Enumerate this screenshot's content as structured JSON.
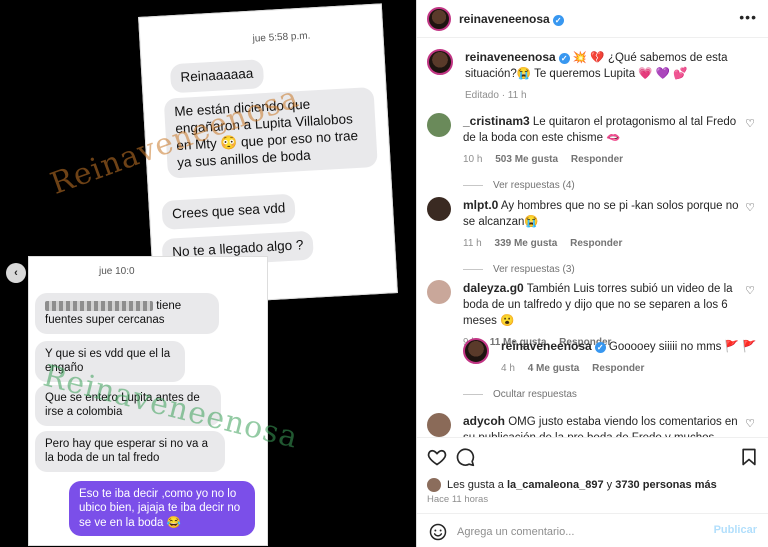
{
  "media": {
    "screenshot_a": {
      "time": "jue 5:58 p.m.",
      "bubbles": [
        "Reinaaaaaa",
        "Me están diciendo que engañaron a Lupita Villalobos en Mty 😳 que por eso no trae ya sus anillos de boda",
        "Crees que sea vdd",
        "No te a llegado algo ?"
      ]
    },
    "screenshot_b": {
      "time": "jue 10:0",
      "bubbles": [
        "tiene fuentes super cercanas",
        "Y que si es vdd que el la engaño",
        "Que se entero Lupita antes de irse a colombia",
        "Pero hay que esperar si no va a la boda de un tal fredo",
        "Eso te iba decir ,como yo no lo ubico bien, jajaja te iba decir no se ve en la boda 😂"
      ]
    },
    "watermark": "Reinaveneenosa",
    "prev_arrow": "‹"
  },
  "post": {
    "username": "reinaveneenosa",
    "caption": "💥 💔 ¿Qué sabemos de esta situación?😭 Te queremos Lupita 💗 💜 💕",
    "edited": "Editado · 11 h",
    "comments": [
      {
        "username": "_cristinam3",
        "text": "Le quitaron el protagonismo al tal Fredo de la boda con este chisme 🫦",
        "time": "10 h",
        "likes": "503 Me gusta",
        "reply": "Responder",
        "view_replies": "Ver respuestas (4)"
      },
      {
        "username": "mlpt.0",
        "text": "Ay hombres que no se pi -kan solos porque no se alcanzan😭",
        "time": "11 h",
        "likes": "339 Me gusta",
        "reply": "Responder",
        "view_replies": "Ver respuestas (3)"
      },
      {
        "username": "daleyza.g0",
        "text": "También Luis torres subió un video de la boda de un talfredo y dijo que no se separen a los 6 meses 😮",
        "time": "9 h",
        "likes": "11 Me gusta",
        "reply": "Responder",
        "hide_replies": "Ocultar respuestas"
      },
      {
        "username": "adycoh",
        "text": "OMG justo estaba viendo los comentarios en su publicación de la pre boda de Fredo y muchos comentarios"
      }
    ],
    "author_reply": {
      "username": "reinaveneenosa",
      "text": "Gooooey siiiii no mms 🚩 🚩",
      "time": "4 h",
      "likes": "4 Me gusta",
      "reply": "Responder"
    },
    "likes_prefix": "Les gusta a",
    "likes_user": "la_camaleona_897",
    "likes_suffix": "y",
    "likes_count": "3730 personas más",
    "posted_ago": "Hace 11 horas",
    "comment_placeholder": "Agrega un comentario...",
    "post_label": "Publicar"
  }
}
